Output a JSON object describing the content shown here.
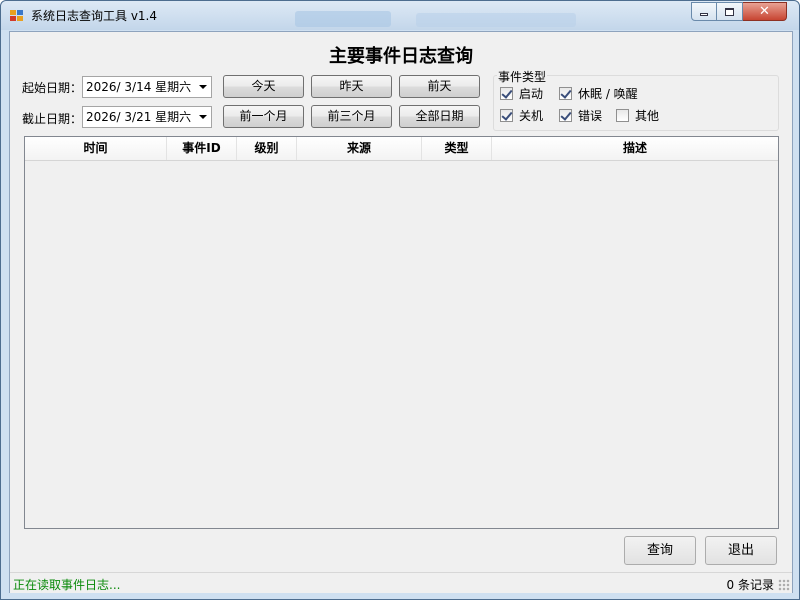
{
  "window": {
    "title": "系统日志查询工具 v1.4"
  },
  "main": {
    "title": "主要事件日志查询"
  },
  "filters": {
    "start_label": "起始日期：",
    "start_value": "2026/  3/14 星期六",
    "end_label": "截止日期：",
    "end_value": "2026/  3/21 星期六"
  },
  "quick_buttons": {
    "today": "今天",
    "yesterday": "昨天",
    "day_before": "前天",
    "last_month": "前一个月",
    "last_three_months": "前三个月",
    "all_dates": "全部日期"
  },
  "event_types": {
    "title": "事件类型",
    "items": [
      {
        "label": "启动",
        "checked": true
      },
      {
        "label": "休眠 / 唤醒",
        "checked": true
      },
      {
        "label": "关机",
        "checked": true
      },
      {
        "label": "错误",
        "checked": true
      },
      {
        "label": "其他",
        "checked": false
      }
    ]
  },
  "table": {
    "columns": [
      "时间",
      "事件ID",
      "级别",
      "来源",
      "类型",
      "描述"
    ],
    "rows": []
  },
  "actions": {
    "query": "查询",
    "exit": "退出"
  },
  "status": {
    "left": "正在读取事件日志...",
    "right": "0 条记录"
  },
  "colors": {
    "status_text": "#0a8a0a"
  }
}
